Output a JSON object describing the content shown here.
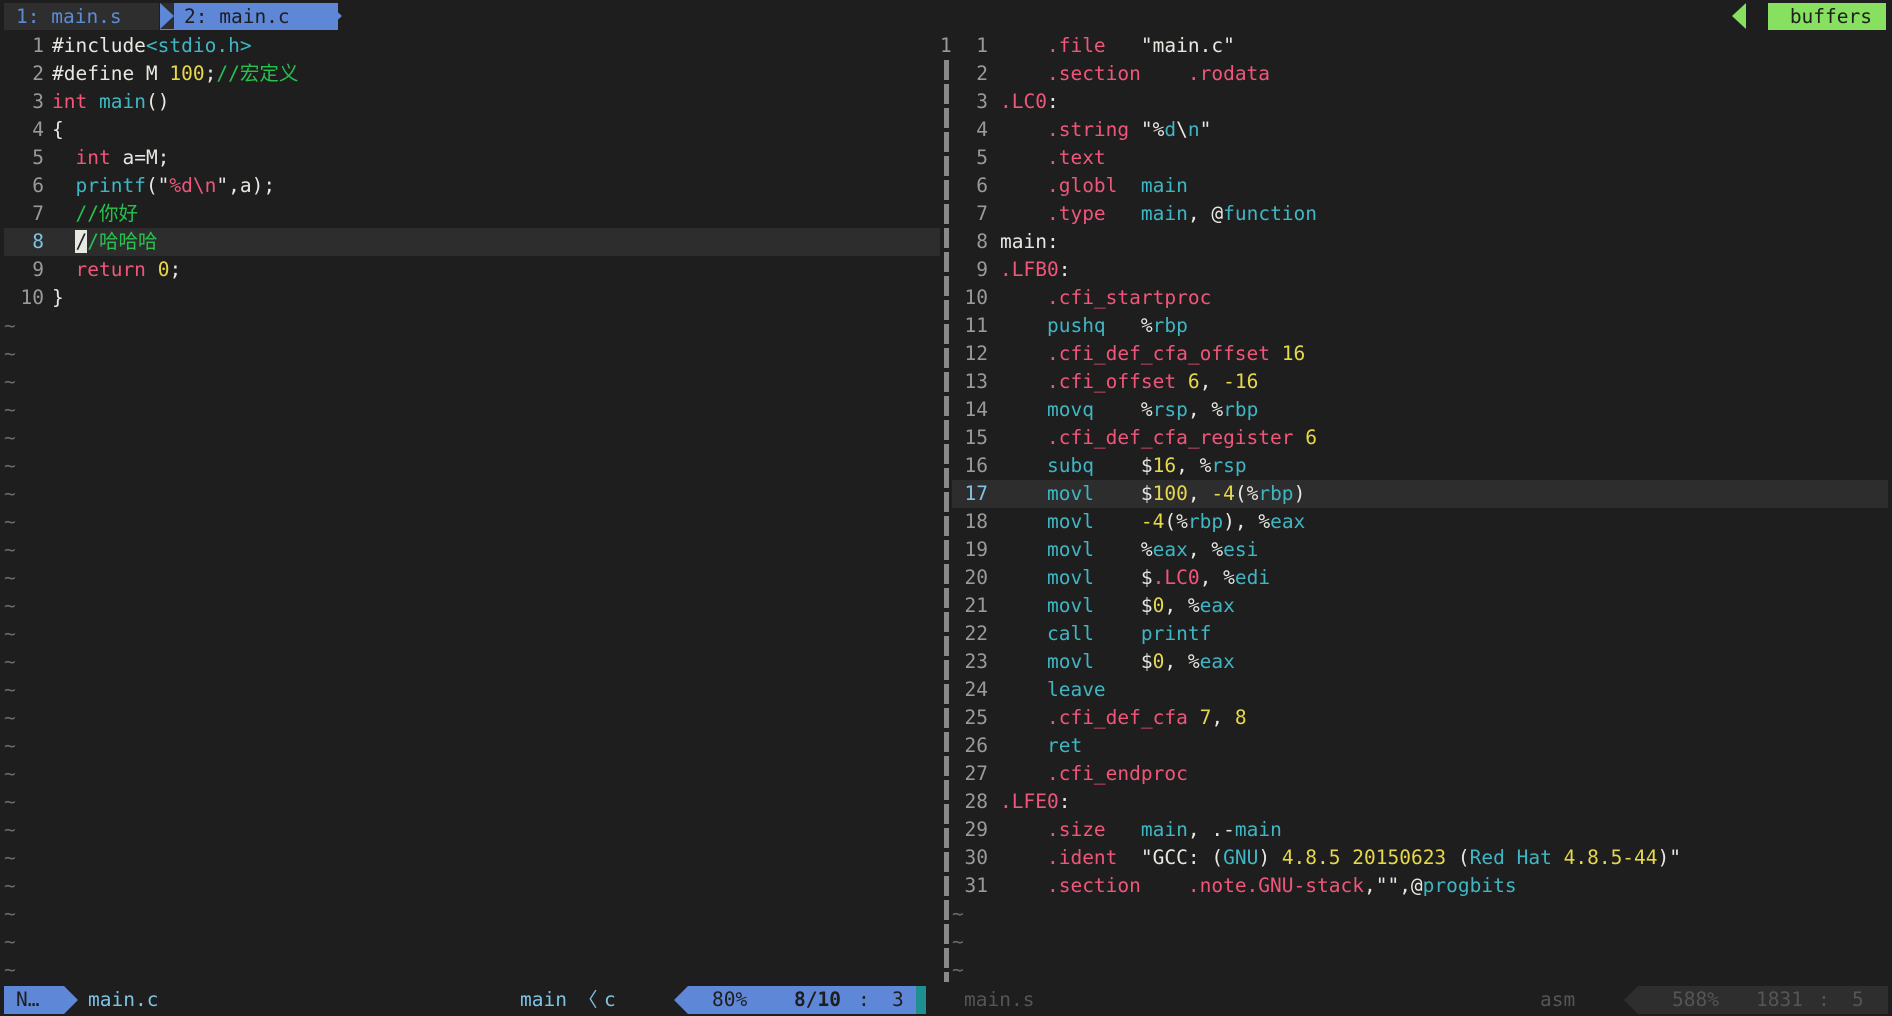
{
  "tabline": {
    "tab1": "1: main.s",
    "tab2": "2: main.c",
    "buffers": "buffers"
  },
  "left_pane": {
    "filename": "main.c",
    "lines": [
      {
        "num": "1",
        "segments": [
          {
            "t": "#include",
            "c": "pre"
          },
          {
            "t": "<stdio.h>",
            "c": "p"
          }
        ]
      },
      {
        "num": "2",
        "segments": [
          {
            "t": "#define M ",
            "c": "pre"
          },
          {
            "t": "100",
            "c": "n"
          },
          {
            "t": ";",
            "c": "pre"
          },
          {
            "t": "//宏定义",
            "c": "c"
          }
        ]
      },
      {
        "num": "3",
        "segments": [
          {
            "t": "int",
            "c": "k"
          },
          {
            "t": " ",
            "c": "s"
          },
          {
            "t": "main",
            "c": "f"
          },
          {
            "t": "()",
            "c": "s"
          }
        ]
      },
      {
        "num": "4",
        "segments": [
          {
            "t": "{",
            "c": "s"
          }
        ]
      },
      {
        "num": "5",
        "segments": [
          {
            "t": "  ",
            "c": "s"
          },
          {
            "t": "int",
            "c": "k"
          },
          {
            "t": " a=M;",
            "c": "s"
          }
        ]
      },
      {
        "num": "6",
        "segments": [
          {
            "t": "  ",
            "c": "s"
          },
          {
            "t": "printf",
            "c": "f"
          },
          {
            "t": "(\"",
            "c": "s"
          },
          {
            "t": "%d\\n",
            "c": "k"
          },
          {
            "t": "\",a);",
            "c": "s"
          }
        ]
      },
      {
        "num": "7",
        "segments": [
          {
            "t": "  ",
            "c": "s"
          },
          {
            "t": "//你好",
            "c": "c"
          }
        ]
      },
      {
        "num": "8",
        "current": true,
        "segments": [
          {
            "t": "  ",
            "c": "s"
          },
          {
            "t": "/",
            "c": "cursor-block"
          },
          {
            "t": "/哈哈哈",
            "c": "c"
          }
        ]
      },
      {
        "num": "9",
        "segments": [
          {
            "t": "  ",
            "c": "s"
          },
          {
            "t": "return",
            "c": "k"
          },
          {
            "t": " ",
            "c": "s"
          },
          {
            "t": "0",
            "c": "n"
          },
          {
            "t": ";",
            "c": "s"
          }
        ]
      },
      {
        "num": "10",
        "segments": [
          {
            "t": "}",
            "c": "s"
          }
        ]
      }
    ],
    "tilde_count": 24
  },
  "right_pane": {
    "filename": "main.s",
    "top_num": "1",
    "lines": [
      {
        "num": "1",
        "segments": [
          {
            "t": "    ",
            "c": "s"
          },
          {
            "t": ".file",
            "c": "dir"
          },
          {
            "t": "   \"main.c\"",
            "c": "s"
          }
        ]
      },
      {
        "num": "2",
        "segments": [
          {
            "t": "    ",
            "c": "s"
          },
          {
            "t": ".section",
            "c": "dir"
          },
          {
            "t": "    ",
            "c": "s"
          },
          {
            "t": ".rodata",
            "c": "dir"
          }
        ]
      },
      {
        "num": "3",
        "segments": [
          {
            "t": ".LC0",
            "c": "lbl"
          },
          {
            "t": ":",
            "c": "s"
          }
        ]
      },
      {
        "num": "4",
        "segments": [
          {
            "t": "    ",
            "c": "s"
          },
          {
            "t": ".string",
            "c": "dir"
          },
          {
            "t": " \"%",
            "c": "s"
          },
          {
            "t": "d",
            "c": "f"
          },
          {
            "t": "\\",
            "c": "s"
          },
          {
            "t": "n",
            "c": "f"
          },
          {
            "t": "\"",
            "c": "s"
          }
        ]
      },
      {
        "num": "5",
        "segments": [
          {
            "t": "    ",
            "c": "s"
          },
          {
            "t": ".text",
            "c": "dir"
          }
        ]
      },
      {
        "num": "6",
        "segments": [
          {
            "t": "    ",
            "c": "s"
          },
          {
            "t": ".globl",
            "c": "dir"
          },
          {
            "t": "  ",
            "c": "s"
          },
          {
            "t": "main",
            "c": "f"
          }
        ]
      },
      {
        "num": "7",
        "segments": [
          {
            "t": "    ",
            "c": "s"
          },
          {
            "t": ".type",
            "c": "dir"
          },
          {
            "t": "   ",
            "c": "s"
          },
          {
            "t": "main",
            "c": "f"
          },
          {
            "t": ", @",
            "c": "s"
          },
          {
            "t": "function",
            "c": "f"
          }
        ]
      },
      {
        "num": "8",
        "segments": [
          {
            "t": "main:",
            "c": "s"
          }
        ]
      },
      {
        "num": "9",
        "segments": [
          {
            "t": ".LFB0",
            "c": "lbl"
          },
          {
            "t": ":",
            "c": "s"
          }
        ]
      },
      {
        "num": "10",
        "segments": [
          {
            "t": "    ",
            "c": "s"
          },
          {
            "t": ".cfi_startproc",
            "c": "dir"
          }
        ]
      },
      {
        "num": "11",
        "segments": [
          {
            "t": "    ",
            "c": "s"
          },
          {
            "t": "pushq",
            "c": "ins"
          },
          {
            "t": "   %",
            "c": "s"
          },
          {
            "t": "rbp",
            "c": "reg"
          }
        ]
      },
      {
        "num": "12",
        "segments": [
          {
            "t": "    ",
            "c": "s"
          },
          {
            "t": ".cfi_def_cfa_offset",
            "c": "dir"
          },
          {
            "t": " ",
            "c": "s"
          },
          {
            "t": "16",
            "c": "n"
          }
        ]
      },
      {
        "num": "13",
        "segments": [
          {
            "t": "    ",
            "c": "s"
          },
          {
            "t": ".cfi_offset",
            "c": "dir"
          },
          {
            "t": " ",
            "c": "s"
          },
          {
            "t": "6",
            "c": "n"
          },
          {
            "t": ", ",
            "c": "s"
          },
          {
            "t": "-16",
            "c": "n"
          }
        ]
      },
      {
        "num": "14",
        "segments": [
          {
            "t": "    ",
            "c": "s"
          },
          {
            "t": "movq",
            "c": "ins"
          },
          {
            "t": "    %",
            "c": "s"
          },
          {
            "t": "rsp",
            "c": "reg"
          },
          {
            "t": ", %",
            "c": "s"
          },
          {
            "t": "rbp",
            "c": "reg"
          }
        ]
      },
      {
        "num": "15",
        "segments": [
          {
            "t": "    ",
            "c": "s"
          },
          {
            "t": ".cfi_def_cfa_register",
            "c": "dir"
          },
          {
            "t": " ",
            "c": "s"
          },
          {
            "t": "6",
            "c": "n"
          }
        ]
      },
      {
        "num": "16",
        "segments": [
          {
            "t": "    ",
            "c": "s"
          },
          {
            "t": "subq",
            "c": "ins"
          },
          {
            "t": "    $",
            "c": "s"
          },
          {
            "t": "16",
            "c": "n"
          },
          {
            "t": ", %",
            "c": "s"
          },
          {
            "t": "rsp",
            "c": "reg"
          }
        ]
      },
      {
        "num": "17",
        "current": true,
        "segments": [
          {
            "t": "    ",
            "c": "s"
          },
          {
            "t": "movl",
            "c": "ins"
          },
          {
            "t": "    $",
            "c": "s"
          },
          {
            "t": "100",
            "c": "n"
          },
          {
            "t": ", ",
            "c": "s"
          },
          {
            "t": "-4",
            "c": "n"
          },
          {
            "t": "(%",
            "c": "s"
          },
          {
            "t": "rbp",
            "c": "reg"
          },
          {
            "t": ")",
            "c": "s"
          }
        ]
      },
      {
        "num": "18",
        "segments": [
          {
            "t": "    ",
            "c": "s"
          },
          {
            "t": "movl",
            "c": "ins"
          },
          {
            "t": "    ",
            "c": "s"
          },
          {
            "t": "-4",
            "c": "n"
          },
          {
            "t": "(%",
            "c": "s"
          },
          {
            "t": "rbp",
            "c": "reg"
          },
          {
            "t": "), %",
            "c": "s"
          },
          {
            "t": "eax",
            "c": "reg"
          }
        ]
      },
      {
        "num": "19",
        "segments": [
          {
            "t": "    ",
            "c": "s"
          },
          {
            "t": "movl",
            "c": "ins"
          },
          {
            "t": "    %",
            "c": "s"
          },
          {
            "t": "eax",
            "c": "reg"
          },
          {
            "t": ", %",
            "c": "s"
          },
          {
            "t": "esi",
            "c": "reg"
          }
        ]
      },
      {
        "num": "20",
        "segments": [
          {
            "t": "    ",
            "c": "s"
          },
          {
            "t": "movl",
            "c": "ins"
          },
          {
            "t": "    $",
            "c": "s"
          },
          {
            "t": ".LC0",
            "c": "lbl"
          },
          {
            "t": ", %",
            "c": "s"
          },
          {
            "t": "edi",
            "c": "reg"
          }
        ]
      },
      {
        "num": "21",
        "segments": [
          {
            "t": "    ",
            "c": "s"
          },
          {
            "t": "movl",
            "c": "ins"
          },
          {
            "t": "    $",
            "c": "s"
          },
          {
            "t": "0",
            "c": "n"
          },
          {
            "t": ", %",
            "c": "s"
          },
          {
            "t": "eax",
            "c": "reg"
          }
        ]
      },
      {
        "num": "22",
        "segments": [
          {
            "t": "    ",
            "c": "s"
          },
          {
            "t": "call",
            "c": "ins"
          },
          {
            "t": "    ",
            "c": "s"
          },
          {
            "t": "printf",
            "c": "f"
          }
        ]
      },
      {
        "num": "23",
        "segments": [
          {
            "t": "    ",
            "c": "s"
          },
          {
            "t": "movl",
            "c": "ins"
          },
          {
            "t": "    $",
            "c": "s"
          },
          {
            "t": "0",
            "c": "n"
          },
          {
            "t": ", %",
            "c": "s"
          },
          {
            "t": "eax",
            "c": "reg"
          }
        ]
      },
      {
        "num": "24",
        "segments": [
          {
            "t": "    ",
            "c": "s"
          },
          {
            "t": "leave",
            "c": "ins"
          }
        ]
      },
      {
        "num": "25",
        "segments": [
          {
            "t": "    ",
            "c": "s"
          },
          {
            "t": ".cfi_def_cfa",
            "c": "dir"
          },
          {
            "t": " ",
            "c": "s"
          },
          {
            "t": "7",
            "c": "n"
          },
          {
            "t": ", ",
            "c": "s"
          },
          {
            "t": "8",
            "c": "n"
          }
        ]
      },
      {
        "num": "26",
        "segments": [
          {
            "t": "    ",
            "c": "s"
          },
          {
            "t": "ret",
            "c": "ins"
          }
        ]
      },
      {
        "num": "27",
        "segments": [
          {
            "t": "    ",
            "c": "s"
          },
          {
            "t": ".cfi_endproc",
            "c": "dir"
          }
        ]
      },
      {
        "num": "28",
        "segments": [
          {
            "t": ".LFE0",
            "c": "lbl"
          },
          {
            "t": ":",
            "c": "s"
          }
        ]
      },
      {
        "num": "29",
        "segments": [
          {
            "t": "    ",
            "c": "s"
          },
          {
            "t": ".size",
            "c": "dir"
          },
          {
            "t": "   ",
            "c": "s"
          },
          {
            "t": "main",
            "c": "f"
          },
          {
            "t": ", .-",
            "c": "s"
          },
          {
            "t": "main",
            "c": "f"
          }
        ]
      },
      {
        "num": "30",
        "segments": [
          {
            "t": "    ",
            "c": "s"
          },
          {
            "t": ".ident",
            "c": "dir"
          },
          {
            "t": "  \"GCC: (",
            "c": "s"
          },
          {
            "t": "GNU",
            "c": "f"
          },
          {
            "t": ") ",
            "c": "s"
          },
          {
            "t": "4.8.5 20150623",
            "c": "n"
          },
          {
            "t": " (",
            "c": "s"
          },
          {
            "t": "Red Hat",
            "c": "f"
          },
          {
            "t": " ",
            "c": "s"
          },
          {
            "t": "4.8.5-44",
            "c": "n"
          },
          {
            "t": ")\"",
            "c": "s"
          }
        ]
      },
      {
        "num": "31",
        "segments": [
          {
            "t": "    ",
            "c": "s"
          },
          {
            "t": ".section",
            "c": "dir"
          },
          {
            "t": "    ",
            "c": "s"
          },
          {
            "t": ".note.GNU-stack",
            "c": "dir"
          },
          {
            "t": ",\"\",@",
            "c": "s"
          },
          {
            "t": "progbits",
            "c": "f"
          }
        ]
      }
    ],
    "tilde_count": 3
  },
  "statusline": {
    "mode": "N…",
    "left_file": "main.c",
    "func": "main",
    "sep": "〈",
    "filetype": "c",
    "percent": "80%",
    "linecount": "8/10",
    "colsep": ":",
    "col": "3",
    "right_file": "main.s",
    "right_filetype": "asm",
    "right_percent": "588%",
    "right_line": "1831",
    "right_colsep": ":",
    "right_col": "5"
  },
  "colors": {
    "background": "#1e1e1e",
    "accent_blue": "#5f87d7",
    "accent_green": "#87e05f",
    "keyword": "#f0567a",
    "function": "#3fb6c4",
    "number": "#e6d84a",
    "comment": "#27c14e"
  }
}
